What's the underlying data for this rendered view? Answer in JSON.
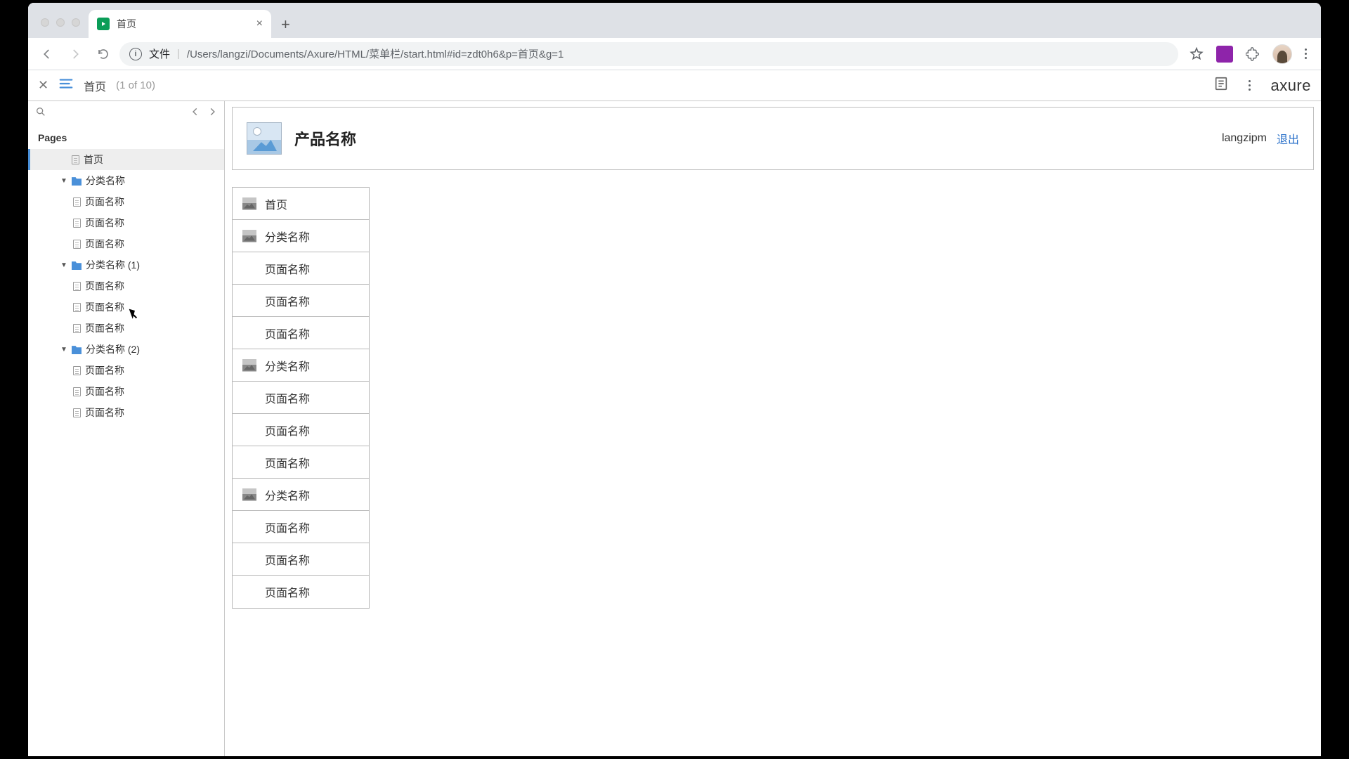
{
  "browser": {
    "tab_title": "首页",
    "url_label": "文件",
    "url_path": "/Users/langzi/Documents/Axure/HTML/菜单栏/start.html#id=zdt0h6&p=首页&g=1"
  },
  "axure_bar": {
    "title": "首页",
    "count": "(1 of 10)",
    "logo": "axure"
  },
  "sidebar": {
    "heading": "Pages",
    "tree": [
      {
        "label": "首页",
        "type": "page",
        "depth": 1,
        "active": true,
        "caret": false
      },
      {
        "label": "分类名称",
        "type": "folder",
        "depth": 1,
        "caret": true
      },
      {
        "label": "页面名称",
        "type": "page",
        "depth": 2,
        "caret": false
      },
      {
        "label": "页面名称",
        "type": "page",
        "depth": 2,
        "caret": false
      },
      {
        "label": "页面名称",
        "type": "page",
        "depth": 2,
        "caret": false
      },
      {
        "label": "分类名称 (1)",
        "type": "folder",
        "depth": 1,
        "caret": true
      },
      {
        "label": "页面名称",
        "type": "page",
        "depth": 2,
        "caret": false
      },
      {
        "label": "页面名称",
        "type": "page",
        "depth": 2,
        "caret": false
      },
      {
        "label": "页面名称",
        "type": "page",
        "depth": 2,
        "caret": false
      },
      {
        "label": "分类名称 (2)",
        "type": "folder",
        "depth": 1,
        "caret": true
      },
      {
        "label": "页面名称",
        "type": "page",
        "depth": 2,
        "caret": false
      },
      {
        "label": "页面名称",
        "type": "page",
        "depth": 2,
        "caret": false
      },
      {
        "label": "页面名称",
        "type": "page",
        "depth": 2,
        "caret": false
      }
    ]
  },
  "prototype": {
    "title": "产品名称",
    "username": "langzipm",
    "logout": "退出",
    "menu": [
      {
        "label": "首页",
        "icon": true,
        "sub": false
      },
      {
        "label": "分类名称",
        "icon": true,
        "sub": false
      },
      {
        "label": "页面名称",
        "icon": false,
        "sub": true
      },
      {
        "label": "页面名称",
        "icon": false,
        "sub": true
      },
      {
        "label": "页面名称",
        "icon": false,
        "sub": true
      },
      {
        "label": "分类名称",
        "icon": true,
        "sub": false
      },
      {
        "label": "页面名称",
        "icon": false,
        "sub": true
      },
      {
        "label": "页面名称",
        "icon": false,
        "sub": true
      },
      {
        "label": "页面名称",
        "icon": false,
        "sub": true
      },
      {
        "label": "分类名称",
        "icon": true,
        "sub": false
      },
      {
        "label": "页面名称",
        "icon": false,
        "sub": true
      },
      {
        "label": "页面名称",
        "icon": false,
        "sub": true
      },
      {
        "label": "页面名称",
        "icon": false,
        "sub": true
      }
    ]
  }
}
